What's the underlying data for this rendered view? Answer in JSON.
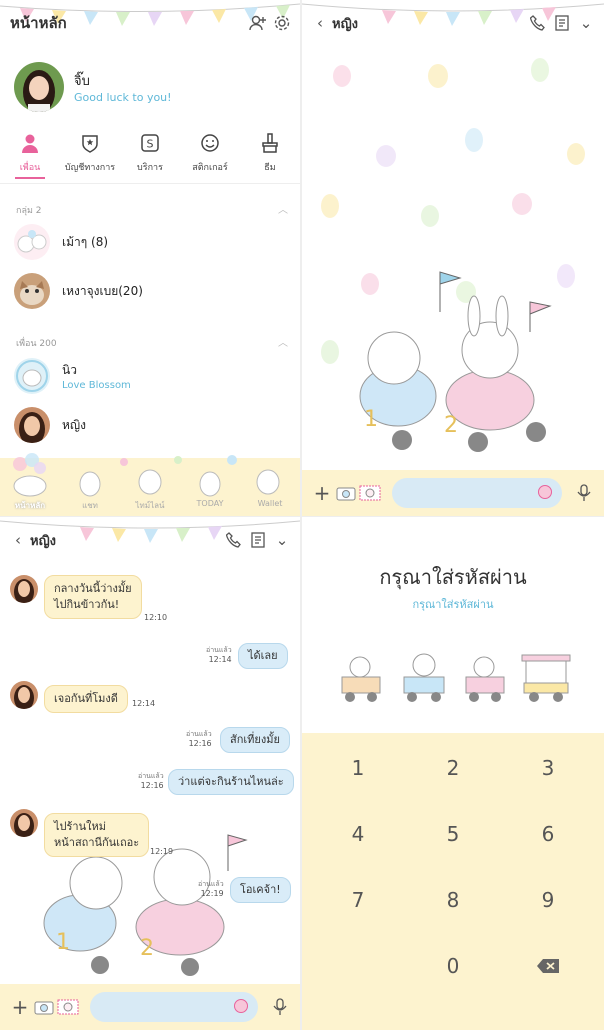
{
  "home": {
    "title": "หน้าหลัก",
    "profile": {
      "name": "จิ๊บ",
      "status": "Good luck to you!"
    },
    "tabs": [
      {
        "label": "เพื่อน",
        "icon": "person-icon"
      },
      {
        "label": "บัญชีทางการ",
        "icon": "shield-icon"
      },
      {
        "label": "บริการ",
        "icon": "services-icon"
      },
      {
        "label": "สติกเกอร์",
        "icon": "smiley-icon"
      },
      {
        "label": "ธีม",
        "icon": "brush-icon"
      }
    ],
    "groups_header": "กลุ่ม 2",
    "groups": [
      {
        "name": "เม้าๆ (8)"
      },
      {
        "name": "เหงาจุงเบย(20)"
      }
    ],
    "friends_header": "เพื่อน 200",
    "friends": [
      {
        "name": "นิว",
        "status": "Love Blossom"
      },
      {
        "name": "หญิง",
        "status": ""
      }
    ],
    "nav": [
      "หน้าหลัก",
      "แชท",
      "ไทม์ไลน์",
      "TODAY",
      "Wallet"
    ]
  },
  "chat": {
    "title": "หญิง",
    "messages": [
      {
        "side": "left",
        "text": "กลางวันนี้ว่างมั้ย\nไปกินข้าวกัน!",
        "time": "12:10",
        "read": ""
      },
      {
        "side": "right",
        "text": "ได้เลย",
        "time": "12:14",
        "read": "อ่านแล้ว"
      },
      {
        "side": "left",
        "text": "เจอกันที่โมงดี",
        "time": "12:14",
        "read": ""
      },
      {
        "side": "right",
        "text": "สักเที่ยงมั้ย",
        "time": "12:16",
        "read": "อ่านแล้ว"
      },
      {
        "side": "right",
        "text": "ว่าแต่จะกินร้านไหนล่ะ",
        "time": "12:16",
        "read": "อ่านแล้ว"
      },
      {
        "side": "left",
        "text": "ไปร้านใหม่\nหน้าสถานีกันเถอะ",
        "time": "12:19",
        "read": ""
      },
      {
        "side": "right",
        "text": "โอเคจ้า!",
        "time": "12:19",
        "read": "อ่านแล้ว"
      }
    ]
  },
  "passcode": {
    "title": "กรุณาใส่รหัสผ่าน",
    "subtitle": "กรุณาใส่รหัสผ่าน",
    "keys": [
      "1",
      "2",
      "3",
      "4",
      "5",
      "6",
      "7",
      "8",
      "9",
      "0"
    ]
  },
  "colors": {
    "accent_pink": "#e8629b",
    "accent_blue": "#5fb8d8",
    "cream": "#fdf3cf",
    "bubble_blue": "#d9ecf8"
  }
}
